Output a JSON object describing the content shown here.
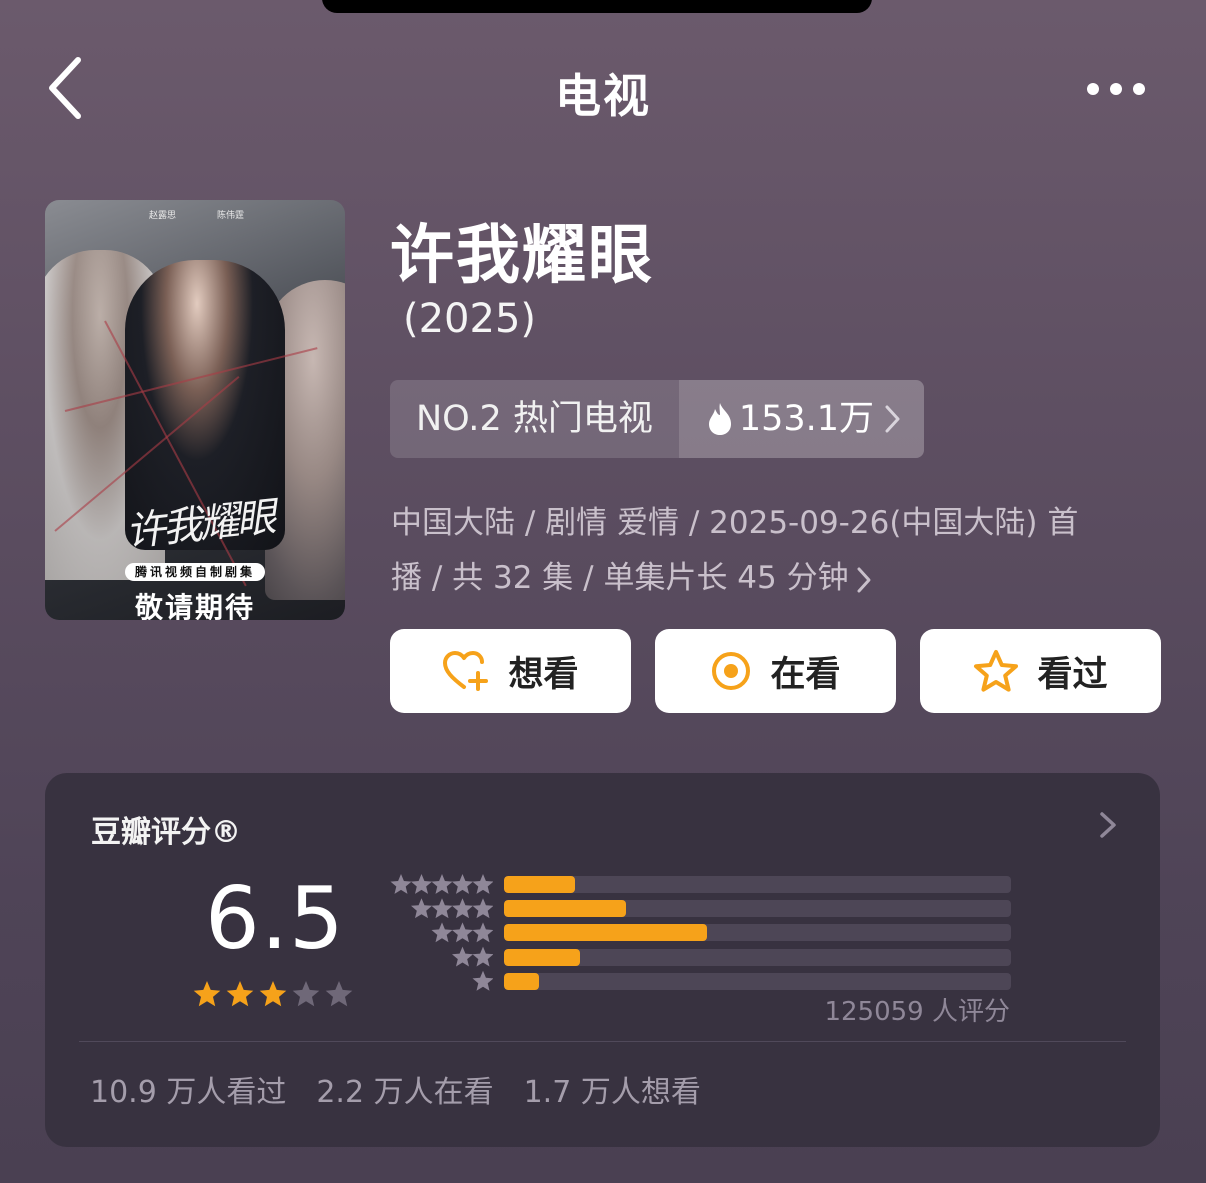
{
  "nav": {
    "title": "电视",
    "back_icon": "chevron-left-icon",
    "more_icon": "more-horizontal-icon"
  },
  "poster": {
    "credits": [
      "赵露思",
      "陈伟霆"
    ],
    "calligraphy": "许我耀眼",
    "badge": "腾讯视频自制剧集",
    "tagline": "敬请期待"
  },
  "show": {
    "title": "许我耀眼",
    "year": "(2025)"
  },
  "rank": {
    "label": "NO.2 热门电视",
    "heat_icon": "flame-icon",
    "heat_value": "153.1万"
  },
  "meta": {
    "line1": "中国大陆 / 剧情 爱情 / 2025-09-26(中国大陆) 首",
    "line2": "播 / 共 32 集 / 单集片长 45 分钟"
  },
  "actions": {
    "want": {
      "label": "想看",
      "icon": "heart-plus-icon"
    },
    "watching": {
      "label": "在看",
      "icon": "target-icon"
    },
    "watched": {
      "label": "看过",
      "icon": "star-outline-icon"
    }
  },
  "rating": {
    "title": "豆瓣评分®",
    "score": "6.5",
    "score_stars_filled": 3,
    "score_stars_total": 5,
    "distribution": [
      {
        "stars": 5,
        "fraction": 0.14
      },
      {
        "stars": 4,
        "fraction": 0.24
      },
      {
        "stars": 3,
        "fraction": 0.4
      },
      {
        "stars": 2,
        "fraction": 0.15
      },
      {
        "stars": 1,
        "fraction": 0.07
      }
    ],
    "count_text": "125059 人评分",
    "stats": {
      "watched": "10.9 万人看过",
      "watching": "2.2 万人在看",
      "want": "1.7 万人想看"
    }
  },
  "colors": {
    "accent": "#f6a21a",
    "card_bg": "#383240",
    "bar_track": "#4d4656"
  }
}
